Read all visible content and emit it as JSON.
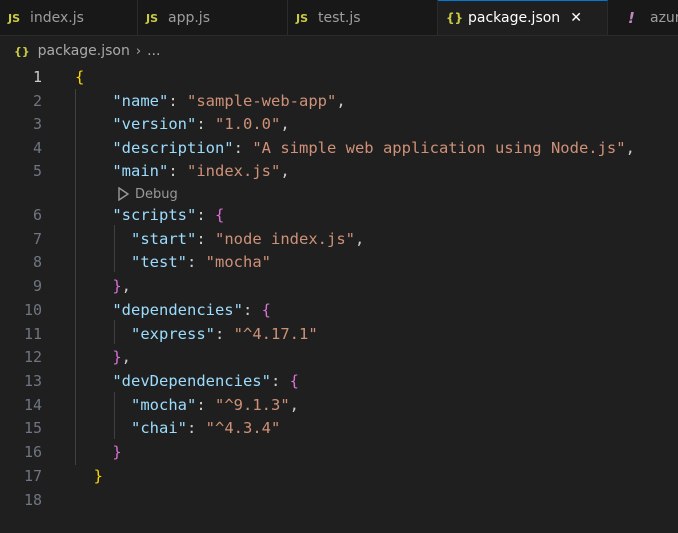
{
  "tabs": [
    {
      "icon": "JS",
      "label": "index.js"
    },
    {
      "icon": "JS",
      "label": "app.js"
    },
    {
      "icon": "JS",
      "label": "test.js"
    },
    {
      "icon": "{}",
      "label": "package.json",
      "close": "✕"
    },
    {
      "icon": "!",
      "label": "azur"
    }
  ],
  "breadcrumb": {
    "icon": "{}",
    "file": "package.json",
    "sep": "›",
    "more": "..."
  },
  "codelens": {
    "label": "Debug"
  },
  "line_numbers": [
    "1",
    "2",
    "3",
    "4",
    "5",
    "6",
    "7",
    "8",
    "9",
    "10",
    "11",
    "12",
    "13",
    "14",
    "15",
    "16",
    "17",
    "18"
  ],
  "code": {
    "l1": "{",
    "name_key": "\"name\"",
    "name_val": "\"sample-web-app\"",
    "version_key": "\"version\"",
    "version_val": "\"1.0.0\"",
    "desc_key": "\"description\"",
    "desc_val": "\"A simple web application using Node.js\"",
    "main_key": "\"main\"",
    "main_val": "\"index.js\"",
    "scripts_key": "\"scripts\"",
    "start_key": "\"start\"",
    "start_val": "\"node index.js\"",
    "test_key": "\"test\"",
    "test_val": "\"mocha\"",
    "deps_key": "\"dependencies\"",
    "express_key": "\"express\"",
    "express_val": "\"^4.17.1\"",
    "devdeps_key": "\"devDependencies\"",
    "mocha_key": "\"mocha\"",
    "mocha_val": "\"^9.1.3\"",
    "chai_key": "\"chai\"",
    "chai_val": "\"^4.3.4\"",
    "close": "}"
  }
}
